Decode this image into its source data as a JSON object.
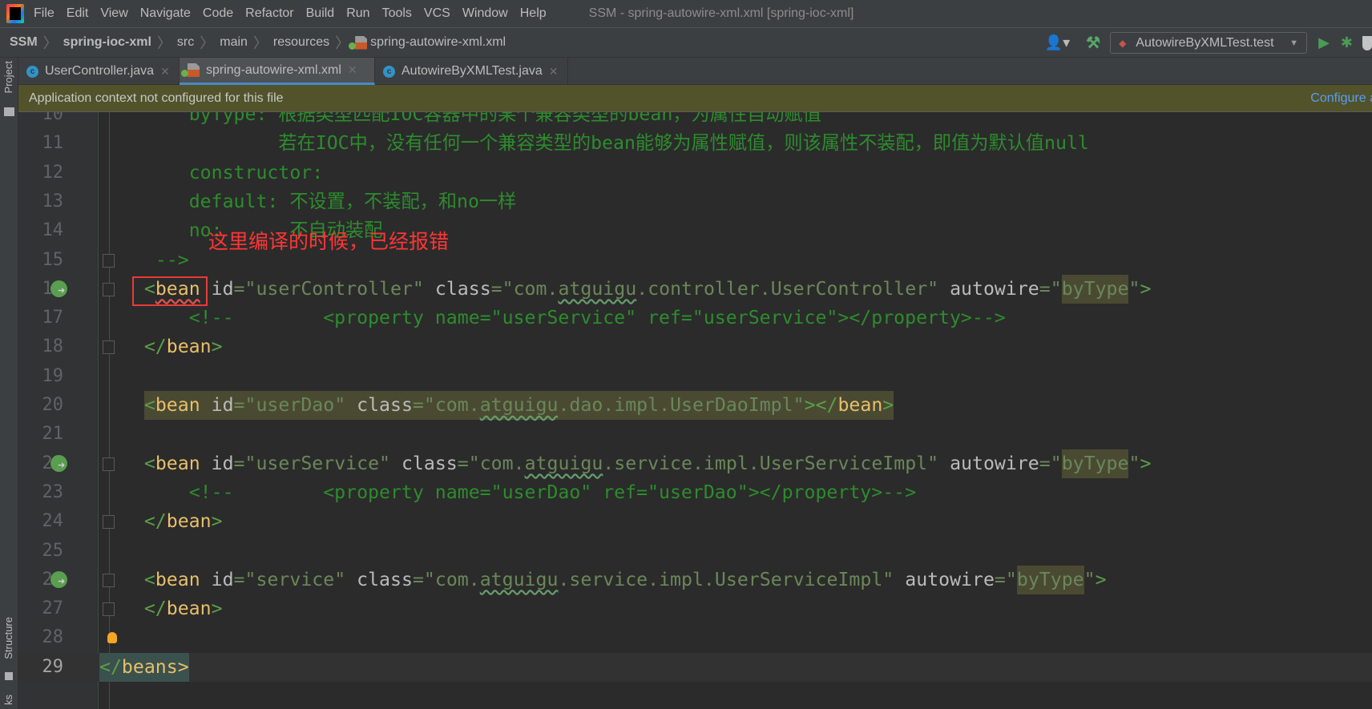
{
  "menubar": {
    "items": [
      "File",
      "Edit",
      "View",
      "Navigate",
      "Code",
      "Refactor",
      "Build",
      "Run",
      "Tools",
      "VCS",
      "Window",
      "Help"
    ],
    "title": "SSM - spring-autowire-xml.xml [spring-ioc-xml]"
  },
  "breadcrumb": [
    "SSM",
    "spring-ioc-xml",
    "src",
    "main",
    "resources",
    "spring-autowire-xml.xml"
  ],
  "toolbar": {
    "run_config": "AutowireByXMLTest.test"
  },
  "tool_windows": {
    "project": "Project",
    "structure": "Structure",
    "bookmarks": "ks"
  },
  "tabs": [
    {
      "label": "UserController.java",
      "icon": "java-class-icon",
      "active": false
    },
    {
      "label": "spring-autowire-xml.xml",
      "icon": "spring-xml-icon",
      "active": true
    },
    {
      "label": "AutowireByXMLTest.java",
      "icon": "java-test-class-icon",
      "active": false
    }
  ],
  "banner": {
    "message": "Application context not configured for this file",
    "link": "Configure a"
  },
  "annotation": {
    "text": "这里编译的时候，已经报错",
    "color": "#ff3535"
  },
  "colors": {
    "accent": "#4a88c7",
    "banner": "#52532a",
    "link": "#589df6",
    "comment": "#2d8c2d",
    "tag": "#e8bf6a",
    "value": "#6a8759"
  },
  "code": [
    {
      "n": 10,
      "tokens": [
        [
          "ws",
          "        "
        ],
        [
          "cmt",
          "byType: 根据类型匹配IOC容器中的某个兼容类型的bean，为属性自动赋值"
        ]
      ]
    },
    {
      "n": 11,
      "tokens": [
        [
          "ws",
          "                "
        ],
        [
          "cmt",
          "若在IOC中，没有任何一个兼容类型的bean能够为属性赋值，则该属性不装配，即值为默认值null"
        ]
      ]
    },
    {
      "n": 12,
      "tokens": [
        [
          "ws",
          "        "
        ],
        [
          "cmt",
          "constructor:"
        ]
      ]
    },
    {
      "n": 13,
      "tokens": [
        [
          "ws",
          "        "
        ],
        [
          "cmt",
          "default: 不设置，不装配，和no一样"
        ]
      ]
    },
    {
      "n": 14,
      "tokens": [
        [
          "ws",
          "        "
        ],
        [
          "cmt",
          "no:      不自动装配"
        ]
      ]
    },
    {
      "n": 15,
      "fold": true,
      "tokens": [
        [
          "ws",
          "     "
        ],
        [
          "cmt",
          "-->"
        ]
      ]
    },
    {
      "n": 16,
      "fold": true,
      "spring": true,
      "tokens": [
        [
          "ws",
          "    "
        ],
        [
          "br",
          "<"
        ],
        [
          "tag err",
          "bean"
        ],
        [
          "ws",
          " "
        ],
        [
          "attr",
          "id"
        ],
        [
          "eq",
          "="
        ],
        [
          "val",
          "\"userController\""
        ],
        [
          "ws",
          " "
        ],
        [
          "attr",
          "class"
        ],
        [
          "eq",
          "="
        ],
        [
          "val",
          "\"com."
        ],
        [
          "val typo",
          "atguigu"
        ],
        [
          "val",
          ".controller.UserController\""
        ],
        [
          "ws",
          " "
        ],
        [
          "attr",
          "autowire"
        ],
        [
          "eq",
          "="
        ],
        [
          "val",
          "\""
        ],
        [
          "val hl",
          "byType"
        ],
        [
          "val",
          "\""
        ],
        [
          "br",
          ">"
        ]
      ]
    },
    {
      "n": 17,
      "tokens": [
        [
          "ws",
          "        "
        ],
        [
          "cmt",
          "<!--        <property name=\"userService\" ref=\"userService\"></property>-->"
        ]
      ]
    },
    {
      "n": 18,
      "fold": true,
      "tokens": [
        [
          "ws",
          "    "
        ],
        [
          "br",
          "</"
        ],
        [
          "tag",
          "bean"
        ],
        [
          "br",
          ">"
        ]
      ]
    },
    {
      "n": 19,
      "tokens": []
    },
    {
      "n": 20,
      "usage": true,
      "tokens": [
        [
          "ws",
          "    "
        ],
        [
          "br",
          "<"
        ],
        [
          "tag",
          "bean"
        ],
        [
          "attr",
          " id"
        ],
        [
          "eq",
          "="
        ],
        [
          "val",
          "\"userDao\""
        ],
        [
          "attr",
          " class"
        ],
        [
          "eq",
          "="
        ],
        [
          "val",
          "\"com."
        ],
        [
          "val typo",
          "atguigu"
        ],
        [
          "val",
          ".dao.impl.UserDaoImpl\""
        ],
        [
          "br",
          "></"
        ],
        [
          "tag",
          "bean"
        ],
        [
          "br",
          ">"
        ]
      ]
    },
    {
      "n": 21,
      "tokens": []
    },
    {
      "n": 22,
      "fold": true,
      "spring": true,
      "tokens": [
        [
          "ws",
          "    "
        ],
        [
          "br",
          "<"
        ],
        [
          "tag",
          "bean"
        ],
        [
          "ws",
          " "
        ],
        [
          "attr",
          "id"
        ],
        [
          "eq",
          "="
        ],
        [
          "val",
          "\"userService\""
        ],
        [
          "ws",
          " "
        ],
        [
          "attr",
          "class"
        ],
        [
          "eq",
          "="
        ],
        [
          "val",
          "\"com."
        ],
        [
          "val typo",
          "atguigu"
        ],
        [
          "val",
          ".service.impl.UserServiceImpl\""
        ],
        [
          "ws",
          " "
        ],
        [
          "attr",
          "autowire"
        ],
        [
          "eq",
          "="
        ],
        [
          "val",
          "\""
        ],
        [
          "val hl",
          "byType"
        ],
        [
          "val",
          "\""
        ],
        [
          "br",
          ">"
        ]
      ]
    },
    {
      "n": 23,
      "tokens": [
        [
          "ws",
          "        "
        ],
        [
          "cmt",
          "<!--        <property name=\"userDao\" ref=\"userDao\"></property>-->"
        ]
      ]
    },
    {
      "n": 24,
      "fold": true,
      "tokens": [
        [
          "ws",
          "    "
        ],
        [
          "br",
          "</"
        ],
        [
          "tag",
          "bean"
        ],
        [
          "br",
          ">"
        ]
      ]
    },
    {
      "n": 25,
      "tokens": []
    },
    {
      "n": 26,
      "fold": true,
      "spring": true,
      "tokens": [
        [
          "ws",
          "    "
        ],
        [
          "br",
          "<"
        ],
        [
          "tag",
          "bean"
        ],
        [
          "ws",
          " "
        ],
        [
          "attr",
          "id"
        ],
        [
          "eq",
          "="
        ],
        [
          "val",
          "\"service\""
        ],
        [
          "ws",
          " "
        ],
        [
          "attr",
          "class"
        ],
        [
          "eq",
          "="
        ],
        [
          "val",
          "\"com."
        ],
        [
          "val typo",
          "atguigu"
        ],
        [
          "val",
          ".service.impl.UserServiceImpl\""
        ],
        [
          "ws",
          " "
        ],
        [
          "attr",
          "autowire"
        ],
        [
          "eq",
          "="
        ],
        [
          "val",
          "\""
        ],
        [
          "val hl",
          "byType"
        ],
        [
          "val",
          "\""
        ],
        [
          "br",
          ">"
        ]
      ]
    },
    {
      "n": 27,
      "fold": true,
      "tokens": [
        [
          "ws",
          "    "
        ],
        [
          "br",
          "</"
        ],
        [
          "tag",
          "bean"
        ],
        [
          "br",
          ">"
        ]
      ]
    },
    {
      "n": 28,
      "bulb": true,
      "tokens": []
    },
    {
      "n": 29,
      "current": true,
      "fold": true,
      "tokens": [
        [
          "br",
          "</"
        ],
        [
          "tag",
          "beans"
        ],
        [
          "tag",
          ">"
        ]
      ]
    }
  ]
}
